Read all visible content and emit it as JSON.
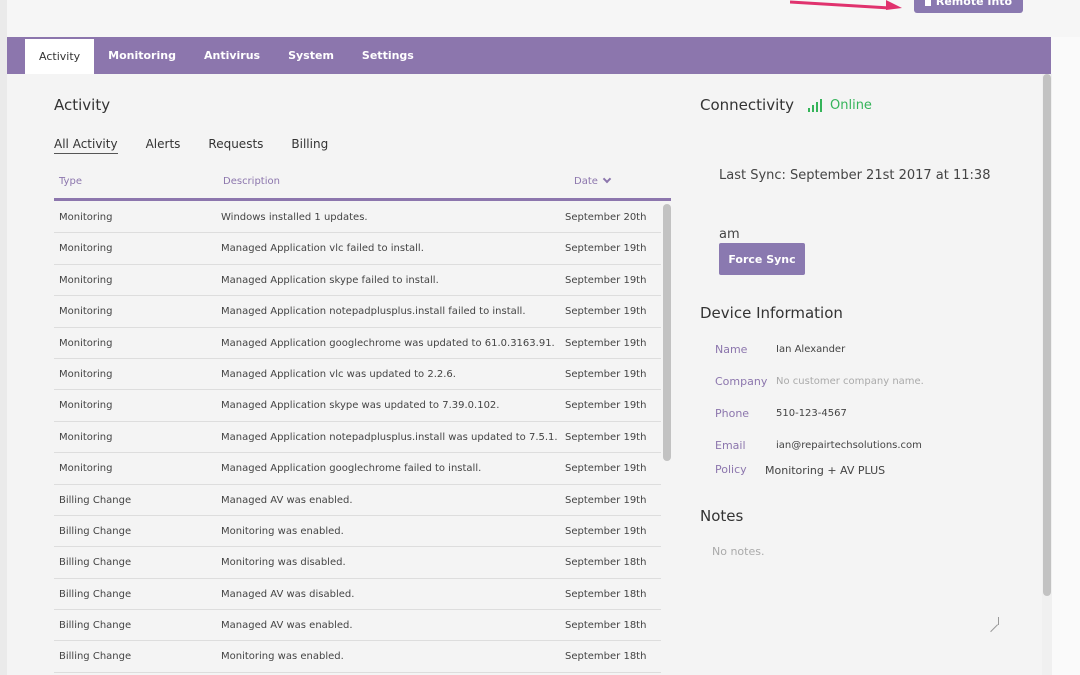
{
  "header": {
    "remote_button": "Remote Into"
  },
  "nav": {
    "tabs": [
      "Activity",
      "Monitoring",
      "Antivirus",
      "System",
      "Settings"
    ],
    "active": "Activity"
  },
  "activity": {
    "title": "Activity",
    "subtabs": [
      "All Activity",
      "Alerts",
      "Requests",
      "Billing"
    ],
    "columns": {
      "type": "Type",
      "description": "Description",
      "date": "Date"
    },
    "rows": [
      {
        "type": "Monitoring",
        "description": "Windows installed 1 updates.",
        "date": "September 20th"
      },
      {
        "type": "Monitoring",
        "description": "Managed Application vlc failed to install.",
        "date": "September 19th"
      },
      {
        "type": "Monitoring",
        "description": "Managed Application skype failed to install.",
        "date": "September 19th"
      },
      {
        "type": "Monitoring",
        "description": "Managed Application notepadplusplus.install failed to install.",
        "date": "September 19th"
      },
      {
        "type": "Monitoring",
        "description": "Managed Application googlechrome was updated to 61.0.3163.91.",
        "date": "September 19th"
      },
      {
        "type": "Monitoring",
        "description": "Managed Application vlc was updated to 2.2.6.",
        "date": "September 19th"
      },
      {
        "type": "Monitoring",
        "description": "Managed Application skype was updated to 7.39.0.102.",
        "date": "September 19th"
      },
      {
        "type": "Monitoring",
        "description": "Managed Application notepadplusplus.install was updated to 7.5.1.",
        "date": "September 19th"
      },
      {
        "type": "Monitoring",
        "description": "Managed Application googlechrome failed to install.",
        "date": "September 19th"
      },
      {
        "type": "Billing Change",
        "description": "Managed AV was enabled.",
        "date": "September 19th"
      },
      {
        "type": "Billing Change",
        "description": "Monitoring was enabled.",
        "date": "September 19th"
      },
      {
        "type": "Billing Change",
        "description": "Monitoring was disabled.",
        "date": "September 18th"
      },
      {
        "type": "Billing Change",
        "description": "Managed AV was disabled.",
        "date": "September 18th"
      },
      {
        "type": "Billing Change",
        "description": "Managed AV was enabled.",
        "date": "September 18th"
      },
      {
        "type": "Billing Change",
        "description": "Monitoring was enabled.",
        "date": "September 18th"
      }
    ]
  },
  "connectivity": {
    "title": "Connectivity",
    "status": "Online",
    "status_color": "#35b45a",
    "last_sync_line1": "Last Sync: September 21st 2017 at 11:38",
    "last_sync_line2": "am",
    "force_sync": "Force Sync"
  },
  "device": {
    "title": "Device Information",
    "name_label": "Name",
    "name_value": "Ian Alexander",
    "company_label": "Company",
    "company_value": "No customer company name.",
    "phone_label": "Phone",
    "phone_value": "510-123-4567",
    "email_label": "Email",
    "email_value": "ian@repairtechsolutions.com",
    "policy_label": "Policy",
    "policy_value": "Monitoring + AV PLUS"
  },
  "notes": {
    "title": "Notes",
    "placeholder": "No notes."
  },
  "colors": {
    "accent": "#8c76ad",
    "online": "#35b45a"
  }
}
